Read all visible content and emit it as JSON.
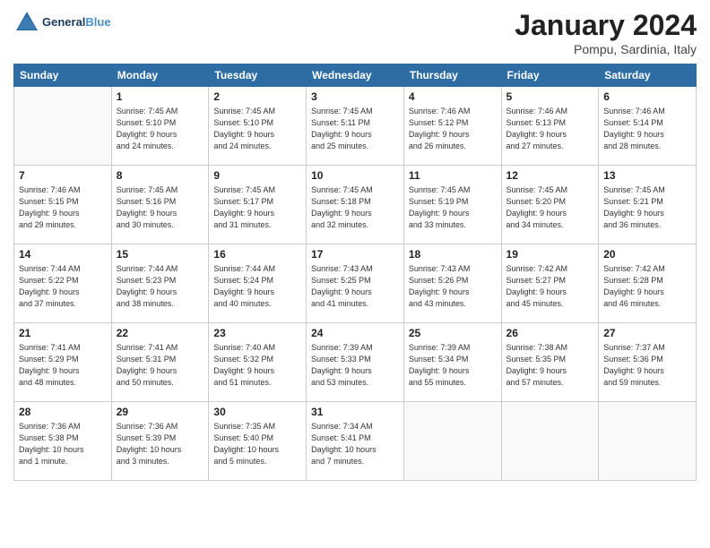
{
  "header": {
    "logo_line1": "General",
    "logo_line2": "Blue",
    "month_title": "January 2024",
    "location": "Pompu, Sardinia, Italy"
  },
  "weekdays": [
    "Sunday",
    "Monday",
    "Tuesday",
    "Wednesday",
    "Thursday",
    "Friday",
    "Saturday"
  ],
  "weeks": [
    [
      {
        "day": "",
        "info": ""
      },
      {
        "day": "1",
        "info": "Sunrise: 7:45 AM\nSunset: 5:10 PM\nDaylight: 9 hours\nand 24 minutes."
      },
      {
        "day": "2",
        "info": "Sunrise: 7:45 AM\nSunset: 5:10 PM\nDaylight: 9 hours\nand 24 minutes."
      },
      {
        "day": "3",
        "info": "Sunrise: 7:45 AM\nSunset: 5:11 PM\nDaylight: 9 hours\nand 25 minutes."
      },
      {
        "day": "4",
        "info": "Sunrise: 7:46 AM\nSunset: 5:12 PM\nDaylight: 9 hours\nand 26 minutes."
      },
      {
        "day": "5",
        "info": "Sunrise: 7:46 AM\nSunset: 5:13 PM\nDaylight: 9 hours\nand 27 minutes."
      },
      {
        "day": "6",
        "info": "Sunrise: 7:46 AM\nSunset: 5:14 PM\nDaylight: 9 hours\nand 28 minutes."
      }
    ],
    [
      {
        "day": "7",
        "info": "Sunrise: 7:46 AM\nSunset: 5:15 PM\nDaylight: 9 hours\nand 29 minutes."
      },
      {
        "day": "8",
        "info": "Sunrise: 7:45 AM\nSunset: 5:16 PM\nDaylight: 9 hours\nand 30 minutes."
      },
      {
        "day": "9",
        "info": "Sunrise: 7:45 AM\nSunset: 5:17 PM\nDaylight: 9 hours\nand 31 minutes."
      },
      {
        "day": "10",
        "info": "Sunrise: 7:45 AM\nSunset: 5:18 PM\nDaylight: 9 hours\nand 32 minutes."
      },
      {
        "day": "11",
        "info": "Sunrise: 7:45 AM\nSunset: 5:19 PM\nDaylight: 9 hours\nand 33 minutes."
      },
      {
        "day": "12",
        "info": "Sunrise: 7:45 AM\nSunset: 5:20 PM\nDaylight: 9 hours\nand 34 minutes."
      },
      {
        "day": "13",
        "info": "Sunrise: 7:45 AM\nSunset: 5:21 PM\nDaylight: 9 hours\nand 36 minutes."
      }
    ],
    [
      {
        "day": "14",
        "info": "Sunrise: 7:44 AM\nSunset: 5:22 PM\nDaylight: 9 hours\nand 37 minutes."
      },
      {
        "day": "15",
        "info": "Sunrise: 7:44 AM\nSunset: 5:23 PM\nDaylight: 9 hours\nand 38 minutes."
      },
      {
        "day": "16",
        "info": "Sunrise: 7:44 AM\nSunset: 5:24 PM\nDaylight: 9 hours\nand 40 minutes."
      },
      {
        "day": "17",
        "info": "Sunrise: 7:43 AM\nSunset: 5:25 PM\nDaylight: 9 hours\nand 41 minutes."
      },
      {
        "day": "18",
        "info": "Sunrise: 7:43 AM\nSunset: 5:26 PM\nDaylight: 9 hours\nand 43 minutes."
      },
      {
        "day": "19",
        "info": "Sunrise: 7:42 AM\nSunset: 5:27 PM\nDaylight: 9 hours\nand 45 minutes."
      },
      {
        "day": "20",
        "info": "Sunrise: 7:42 AM\nSunset: 5:28 PM\nDaylight: 9 hours\nand 46 minutes."
      }
    ],
    [
      {
        "day": "21",
        "info": "Sunrise: 7:41 AM\nSunset: 5:29 PM\nDaylight: 9 hours\nand 48 minutes."
      },
      {
        "day": "22",
        "info": "Sunrise: 7:41 AM\nSunset: 5:31 PM\nDaylight: 9 hours\nand 50 minutes."
      },
      {
        "day": "23",
        "info": "Sunrise: 7:40 AM\nSunset: 5:32 PM\nDaylight: 9 hours\nand 51 minutes."
      },
      {
        "day": "24",
        "info": "Sunrise: 7:39 AM\nSunset: 5:33 PM\nDaylight: 9 hours\nand 53 minutes."
      },
      {
        "day": "25",
        "info": "Sunrise: 7:39 AM\nSunset: 5:34 PM\nDaylight: 9 hours\nand 55 minutes."
      },
      {
        "day": "26",
        "info": "Sunrise: 7:38 AM\nSunset: 5:35 PM\nDaylight: 9 hours\nand 57 minutes."
      },
      {
        "day": "27",
        "info": "Sunrise: 7:37 AM\nSunset: 5:36 PM\nDaylight: 9 hours\nand 59 minutes."
      }
    ],
    [
      {
        "day": "28",
        "info": "Sunrise: 7:36 AM\nSunset: 5:38 PM\nDaylight: 10 hours\nand 1 minute."
      },
      {
        "day": "29",
        "info": "Sunrise: 7:36 AM\nSunset: 5:39 PM\nDaylight: 10 hours\nand 3 minutes."
      },
      {
        "day": "30",
        "info": "Sunrise: 7:35 AM\nSunset: 5:40 PM\nDaylight: 10 hours\nand 5 minutes."
      },
      {
        "day": "31",
        "info": "Sunrise: 7:34 AM\nSunset: 5:41 PM\nDaylight: 10 hours\nand 7 minutes."
      },
      {
        "day": "",
        "info": ""
      },
      {
        "day": "",
        "info": ""
      },
      {
        "day": "",
        "info": ""
      }
    ]
  ]
}
